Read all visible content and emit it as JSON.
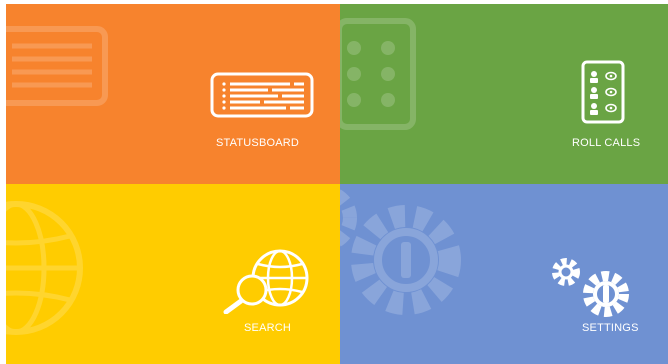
{
  "tiles": {
    "statusboard": {
      "label": "STATUSBOARD",
      "icon": "statusboard-icon",
      "color": "#f7832d"
    },
    "roll_calls": {
      "label": "ROLL CALLS",
      "icon": "roll-call-icon",
      "color": "#6aa444"
    },
    "search": {
      "label": "SEARCH",
      "icon": "globe-search-icon",
      "color": "#ffcc00"
    },
    "settings": {
      "label": "SETTINGS",
      "icon": "gears-icon",
      "color": "#6f91d2"
    }
  }
}
